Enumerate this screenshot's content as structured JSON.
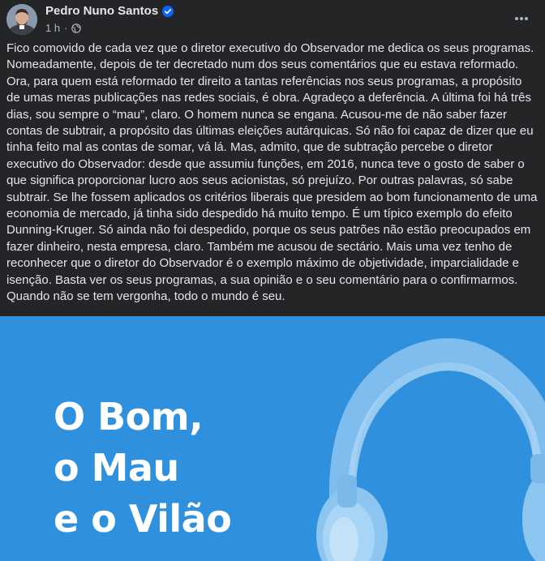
{
  "post": {
    "author": "Pedro Nuno Santos",
    "timestamp": "1 h",
    "separator": "·",
    "text": "Fico comovido de cada vez que o diretor executivo do Observador me dedica os seus programas. Nomeadamente, depois de ter decretado num dos seus comentários que eu estava reformado. Ora, para quem está reformado ter direito a tantas referências nos seus programas, a propósito de umas meras publicações nas redes sociais, é obra. Agradeço a deferência. A última foi há três dias, sou sempre o “mau”, claro. O homem nunca se engana. Acusou-me de não saber fazer contas de subtrair, a propósito das últimas eleições autárquicas. Só não foi capaz de dizer que eu tinha feito mal as contas de somar, vá lá. Mas, admito, que de subtração percebe o diretor executivo do Observador: desde que assumiu funções, em 2016, nunca teve o gosto de saber o que significa proporcionar lucro aos seus acionistas, só prejuízo. Por outras palavras, só sabe subtrair. Se lhe fossem aplicados os critérios liberais que presidem ao bom funcionamento de uma economia de mercado, já tinha sido despedido há muito tempo. É um típico exemplo do efeito Dunning-Kruger. Só ainda não foi despedido, porque os seus patrões não estão preocupados em fazer dinheiro, nesta empresa, claro. Também me acusou de sectário. Mais uma vez tenho de reconhecer que o diretor do Observador é o exemplo máximo de objetividade, imparcialidade e isenção. Basta ver os seus programas, a sua opinião e o seu comentário para o confirmarmos. Quando não se tem vergonha, todo o mundo é seu."
  },
  "image": {
    "title_lines": [
      "O Bom,",
      "o Mau",
      "e o Vilão"
    ]
  },
  "icons": {
    "verified": "verified-badge-icon",
    "audience": "globe-icon",
    "more": "more-horizontal-icon",
    "illustration": "headphones-icon"
  },
  "colors": {
    "background": "#242526",
    "text_primary": "#e4e6eb",
    "text_secondary": "#b0b3b8",
    "verified_blue": "#0866ff",
    "image_background": "#2f91dd"
  }
}
